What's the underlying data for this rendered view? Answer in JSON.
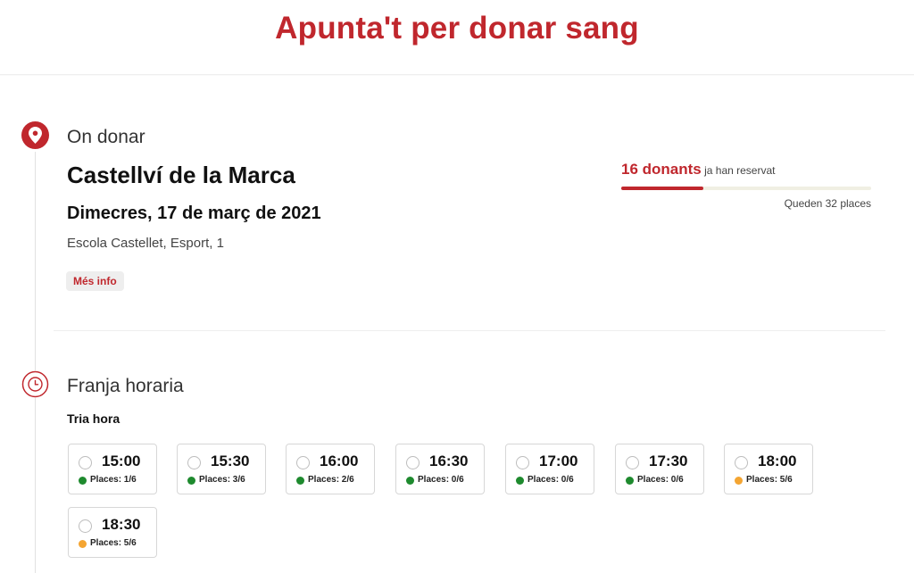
{
  "header": {
    "title": "Apunta't per donar sang"
  },
  "location_section": {
    "title": "On donar",
    "place": "Castellví de la Marca",
    "date": "Dimecres, 17 de març de 2021",
    "address": "Escola Castellet, Esport, 1",
    "more_info_label": "Més info",
    "icon": "map-pin-icon"
  },
  "donors": {
    "count_label": "16 donants",
    "reserved_text": "ja han reservat",
    "remaining_text": "Queden 32 places",
    "progress_fraction": 0.33
  },
  "time_section": {
    "title": "Franja horaria",
    "pick_label": "Tria hora",
    "icon": "clock-icon"
  },
  "slots": [
    {
      "time": "15:00",
      "places": "Places: 1/6",
      "status": "available"
    },
    {
      "time": "15:30",
      "places": "Places: 3/6",
      "status": "available"
    },
    {
      "time": "16:00",
      "places": "Places: 2/6",
      "status": "available"
    },
    {
      "time": "16:30",
      "places": "Places: 0/6",
      "status": "available"
    },
    {
      "time": "17:00",
      "places": "Places: 0/6",
      "status": "available"
    },
    {
      "time": "17:30",
      "places": "Places: 0/6",
      "status": "available"
    },
    {
      "time": "18:00",
      "places": "Places: 5/6",
      "status": "almost-full"
    },
    {
      "time": "18:30",
      "places": "Places: 5/6",
      "status": "almost-full"
    }
  ],
  "colors": {
    "brand": "#c0272d",
    "status_available": "#1e8a2e",
    "status_almost_full": "#f4a532"
  }
}
